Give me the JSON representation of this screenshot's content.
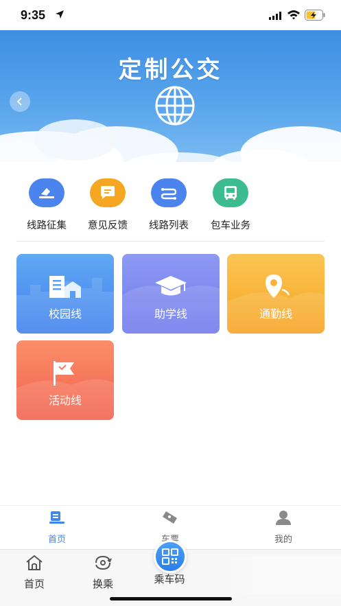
{
  "status_bar": {
    "time": "9:35"
  },
  "banner": {
    "title": "定制公交"
  },
  "quick_actions": [
    {
      "label": "线路征集",
      "icon": "vote-icon",
      "color": "#4a84ec"
    },
    {
      "label": "意见反馈",
      "icon": "chat-bubble-icon",
      "color": "#f5a623"
    },
    {
      "label": "线路列表",
      "icon": "route-icon",
      "color": "#4a84ec"
    },
    {
      "label": "包车业务",
      "icon": "bus-icon",
      "color": "#3dbd8f"
    }
  ],
  "tiles": [
    {
      "label": "校园线",
      "icon": "school-building-icon"
    },
    {
      "label": "助学线",
      "icon": "graduation-cap-icon"
    },
    {
      "label": "通勤线",
      "icon": "location-pin-icon"
    },
    {
      "label": "活动线",
      "icon": "flag-icon"
    }
  ],
  "inner_tabs": [
    {
      "label": "首页",
      "active": true
    },
    {
      "label": "车票",
      "active": false
    },
    {
      "label": "我的",
      "active": false
    }
  ],
  "bottom_tabs": [
    {
      "label": "首页"
    },
    {
      "label": "换乘"
    },
    {
      "label": "乘车码"
    }
  ],
  "colors": {
    "accent": "#3f86f0"
  }
}
